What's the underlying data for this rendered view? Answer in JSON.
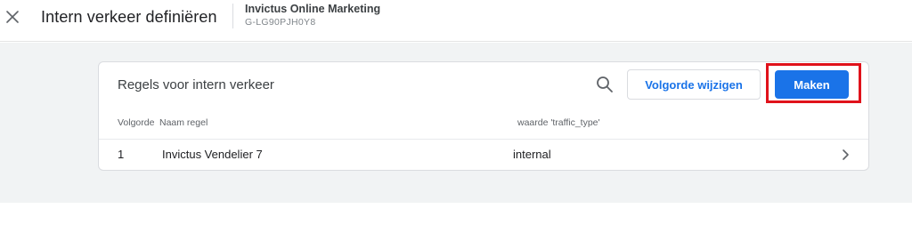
{
  "header": {
    "title": "Intern verkeer definiëren",
    "account_name": "Invictus Online Marketing",
    "measurement_id": "G-LG90PJH0Y8"
  },
  "card": {
    "title": "Regels voor intern verkeer",
    "reorder_label": "Volgorde wijzigen",
    "create_label": "Maken",
    "columns": [
      "Volgorde",
      "Naam regel",
      "waarde 'traffic_type'"
    ],
    "rows": [
      {
        "order": "1",
        "name": "Invictus Vendelier 7",
        "value": "internal"
      }
    ]
  },
  "icons": {
    "close": "close-icon",
    "search": "search-icon",
    "row_chevron": "chevron-right-icon"
  },
  "colors": {
    "accent": "#1a73e8",
    "highlight": "#e0121b",
    "background": "#f1f3f4"
  }
}
